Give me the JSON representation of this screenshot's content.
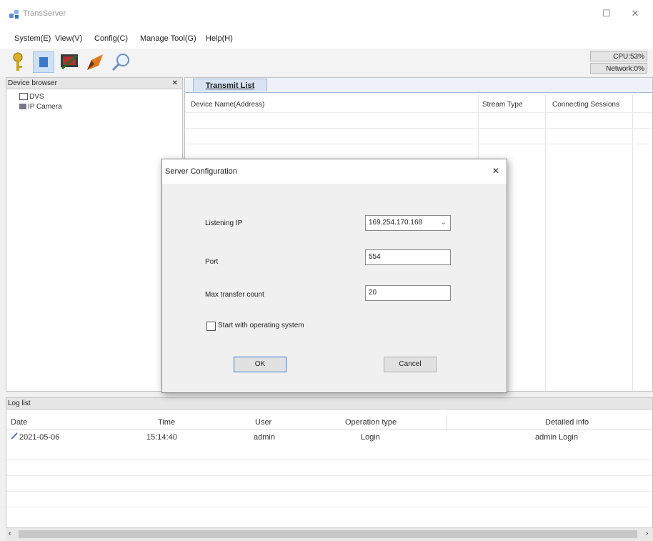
{
  "window": {
    "title": "TransServer",
    "maximize_glyph": "☐",
    "close_glyph": "✕"
  },
  "menu": [
    "System(E)",
    "View(V)",
    "Config(C)",
    "Manage Tool(G)",
    "Help(H)"
  ],
  "toolbar": {
    "icons": [
      "key-icon",
      "login-icon",
      "monitor-config-icon",
      "edit-icon",
      "search-icon"
    ]
  },
  "status": {
    "cpu": "CPU:53%",
    "network": "Network:0%"
  },
  "device_browser": {
    "title": "Device browser",
    "close_glyph": "✕",
    "items": [
      "DVS",
      "IP Camera"
    ]
  },
  "transmit": {
    "tab": "Transmit List",
    "columns": [
      "Device Name(Address)",
      "Stream Type",
      "Connecting Sessions"
    ]
  },
  "dialog": {
    "title": "Server Configuration",
    "close_glyph": "✕",
    "listening_ip_label": "Listening IP",
    "listening_ip_value": "169.254.170.168",
    "port_label": "Port",
    "port_value": "554",
    "max_transfer_label": "Max transfer count",
    "max_transfer_value": "20",
    "startup_label": "Start with operating system",
    "startup_checked": false,
    "ok_label": "OK",
    "cancel_label": "Cancel"
  },
  "log": {
    "title": "Log list",
    "columns": [
      "Date",
      "Time",
      "User",
      "Operation type",
      "Detailed info"
    ],
    "rows": [
      {
        "date": "2021-05-06",
        "time": "15:14:40",
        "user": "admin",
        "operation": "Login",
        "info": "admin Login"
      }
    ]
  }
}
